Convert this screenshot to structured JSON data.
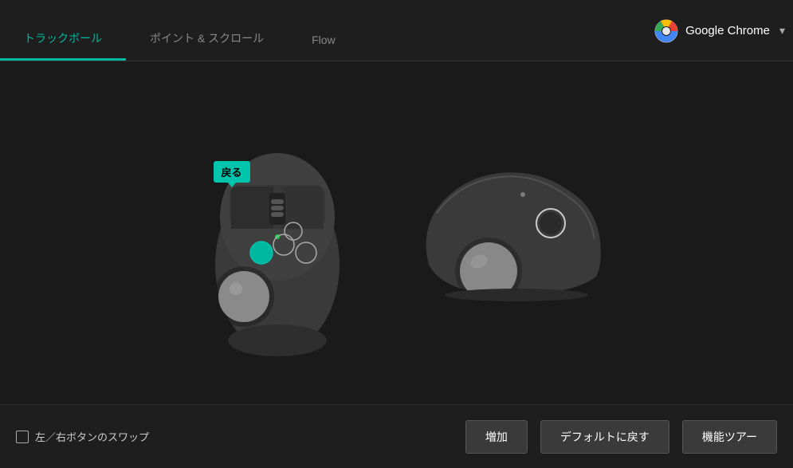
{
  "tabs": [
    {
      "id": "trackball",
      "label": "トラックボール",
      "active": true
    },
    {
      "id": "pointscroll",
      "label": "ポイント & スクロール",
      "active": false
    },
    {
      "id": "flow",
      "label": "Flow",
      "active": false
    }
  ],
  "app_selector": {
    "name": "Google Chrome",
    "dropdown_label": "▾"
  },
  "tooltip": {
    "label": "戻る"
  },
  "bottom": {
    "checkbox_label": "左／右ボタンのスワップ",
    "btn_increase": "増加",
    "btn_default": "デフォルトに戻す",
    "btn_tour": "機能ツアー"
  },
  "window_controls": {
    "minimize": "—",
    "close": "✕"
  }
}
